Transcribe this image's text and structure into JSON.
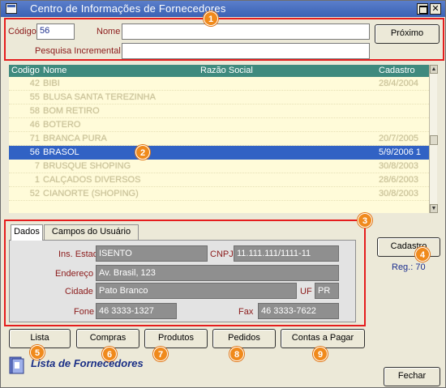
{
  "window": {
    "title": "Centro de Informações de Fornecedores"
  },
  "search": {
    "codigo_label": "Código",
    "codigo_value": "56",
    "nome_label": "Nome",
    "nome_value": "",
    "incremental_label": "Pesquisa Incremental",
    "incremental_value": "",
    "next_button": "Próximo"
  },
  "grid": {
    "columns": [
      "Codigo",
      "Nome",
      "Razão Social",
      "Cadastro"
    ],
    "rows": [
      {
        "code": "42",
        "name": "BIBI",
        "date": "28/4/2004"
      },
      {
        "code": "55",
        "name": "BLUSA SANTA TEREZINHA",
        "date": ""
      },
      {
        "code": "58",
        "name": "BOM RETIRO",
        "date": ""
      },
      {
        "code": "46",
        "name": "BOTERO",
        "date": ""
      },
      {
        "code": "71",
        "name": "BRANCA PURA",
        "date": "20/7/2005"
      },
      {
        "code": "56",
        "name": "BRASOL",
        "date": "5/9/2006 1",
        "selected": true
      },
      {
        "code": "7",
        "name": "BRUSQUE SHOPING",
        "date": "30/8/2003"
      },
      {
        "code": "1",
        "name": "CALÇADOS DIVERSOS",
        "date": "28/6/2003"
      },
      {
        "code": "52",
        "name": "CIANORTE (SHOPING)",
        "date": "30/8/2003"
      }
    ]
  },
  "tabs": [
    "Dados",
    "Campos do Usuário"
  ],
  "details": {
    "ins_estadual_label": "Ins. Estadual",
    "ins_estadual_value": "ISENTO",
    "cnpj_label": "CNPJ",
    "cnpj_value": "11.111.111/1111-11",
    "endereco_label": "Endereço",
    "endereco_value": "Av. Brasil, 123",
    "cidade_label": "Cidade",
    "cidade_value": "Pato Branco",
    "uf_label": "UF",
    "uf_value": "PR",
    "fone_label": "Fone",
    "fone_value": "46 3333-1327",
    "fax_label": "Fax",
    "fax_value": "46 3333-7622"
  },
  "side": {
    "cadastro_button": "Cadastro",
    "reg_label": "Reg.: 70"
  },
  "bottom_buttons": [
    "Lista",
    "Compras",
    "Produtos",
    "Pedidos",
    "Contas a Pagar"
  ],
  "footer": {
    "title": "Lista de Fornecedores",
    "close_button": "Fechar"
  },
  "badges": [
    "1",
    "2",
    "3",
    "4",
    "5",
    "6",
    "7",
    "8",
    "9"
  ],
  "colors": {
    "titlebar": "#3b62b4",
    "highlight_box": "#e51d1d",
    "badge": "#f08a1c",
    "grid_header": "#3f8a7e",
    "selected_row": "#3162c4",
    "row_bg": "#fffbd9",
    "label_text": "#8b1a1a"
  }
}
